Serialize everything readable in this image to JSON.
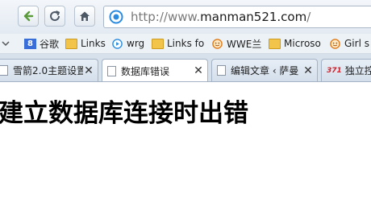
{
  "browser": {
    "url_prefix": "http://www.",
    "url_domain": "manman521.com",
    "url_suffix": "/"
  },
  "bookmarks": [
    {
      "label": "谷歌",
      "icon": "google-icon"
    },
    {
      "label": "Links",
      "icon": "folder-icon"
    },
    {
      "label": "wrg",
      "icon": "play-icon"
    },
    {
      "label": "Links fo",
      "icon": "folder-icon"
    },
    {
      "label": "WWE兰",
      "icon": "smiley-icon"
    },
    {
      "label": "Microso",
      "icon": "folder-icon"
    },
    {
      "label": "Girl s",
      "icon": "smiley-icon"
    }
  ],
  "tabs": [
    {
      "label": "雪箭2.0主题设置",
      "active": false
    },
    {
      "label": "数据库错误",
      "active": true
    },
    {
      "label": "编辑文章 ‹ 萨曼",
      "active": false
    },
    {
      "label": "独立控",
      "active": false,
      "badge": "371"
    }
  ],
  "page": {
    "heading": "建立数据库连接时出错"
  },
  "colors": {
    "accent": "#2a8be0",
    "badge": "#d4202a",
    "folder": "#f3c44a"
  }
}
